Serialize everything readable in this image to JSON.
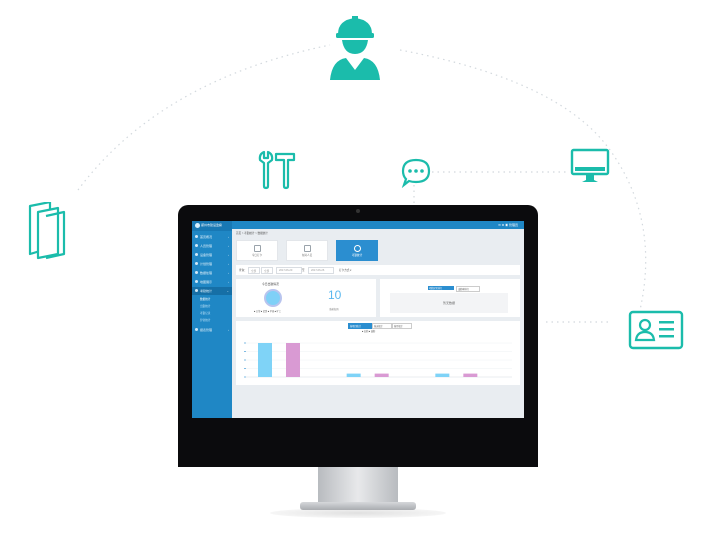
{
  "colors": {
    "accent": "#1bbcab",
    "dashed": "#cfd6dc",
    "sidebar": "#1f87c5",
    "bar_blue": "#7fd3f7",
    "bar_pink": "#d99ad3"
  },
  "icons": [
    "worker-helmet-icon",
    "tools-icon",
    "chat-bubble-icon",
    "monitor-icon",
    "documents-icon",
    "id-card-icon",
    "apple-logo-icon"
  ],
  "app": {
    "logo_text": "郑州市建设监察",
    "top_icons": "✉ ⚙ ◉ 管理员",
    "breadcrumb": "首页 > 考勤统计 > 数据统计",
    "sidebar": [
      {
        "label": "首页概况"
      },
      {
        "label": "人员管理"
      },
      {
        "label": "设备管理"
      },
      {
        "label": "计划管理"
      },
      {
        "label": "数据处理"
      },
      {
        "label": "地图展示"
      },
      {
        "label": "考勤统计"
      },
      {
        "label": "报表管理"
      }
    ],
    "sidebar_sub": [
      "数据统计",
      "出勤统计",
      "考勤记录",
      "异常统计"
    ],
    "tiles": [
      {
        "label": "今日打卡"
      },
      {
        "label": "在岗人员"
      },
      {
        "label": "考勤统计"
      }
    ],
    "filter": {
      "label": "查询：",
      "opt1": "全部",
      "opt2": "全部",
      "date_from": "2017-06-20",
      "sep": "至",
      "date_to": "2017-06-26",
      "extra": "打卡方式 ▾"
    },
    "left_panel": {
      "title": "今日出勤情况",
      "number": "10",
      "number_label": "当前在岗",
      "legend": "■ 正常 ■ 迟到 ■ 早退 ■ 旷工"
    },
    "right_panel": {
      "tab_on": "考勤异常排行",
      "tab_off": "出勤率排行",
      "empty_text": "暂无数据"
    },
    "chart_tabs": [
      "按项目统计",
      "按天统计",
      "按月统计"
    ],
    "chart_legend": "■ 出勤 ■ 缺勤"
  },
  "chart_data": {
    "type": "bar",
    "categories": [
      "",
      "",
      ""
    ],
    "series": [
      {
        "values": [
          10,
          1,
          1
        ]
      },
      {
        "values": [
          10,
          1,
          1
        ]
      }
    ],
    "ylim": [
      0,
      10
    ]
  }
}
